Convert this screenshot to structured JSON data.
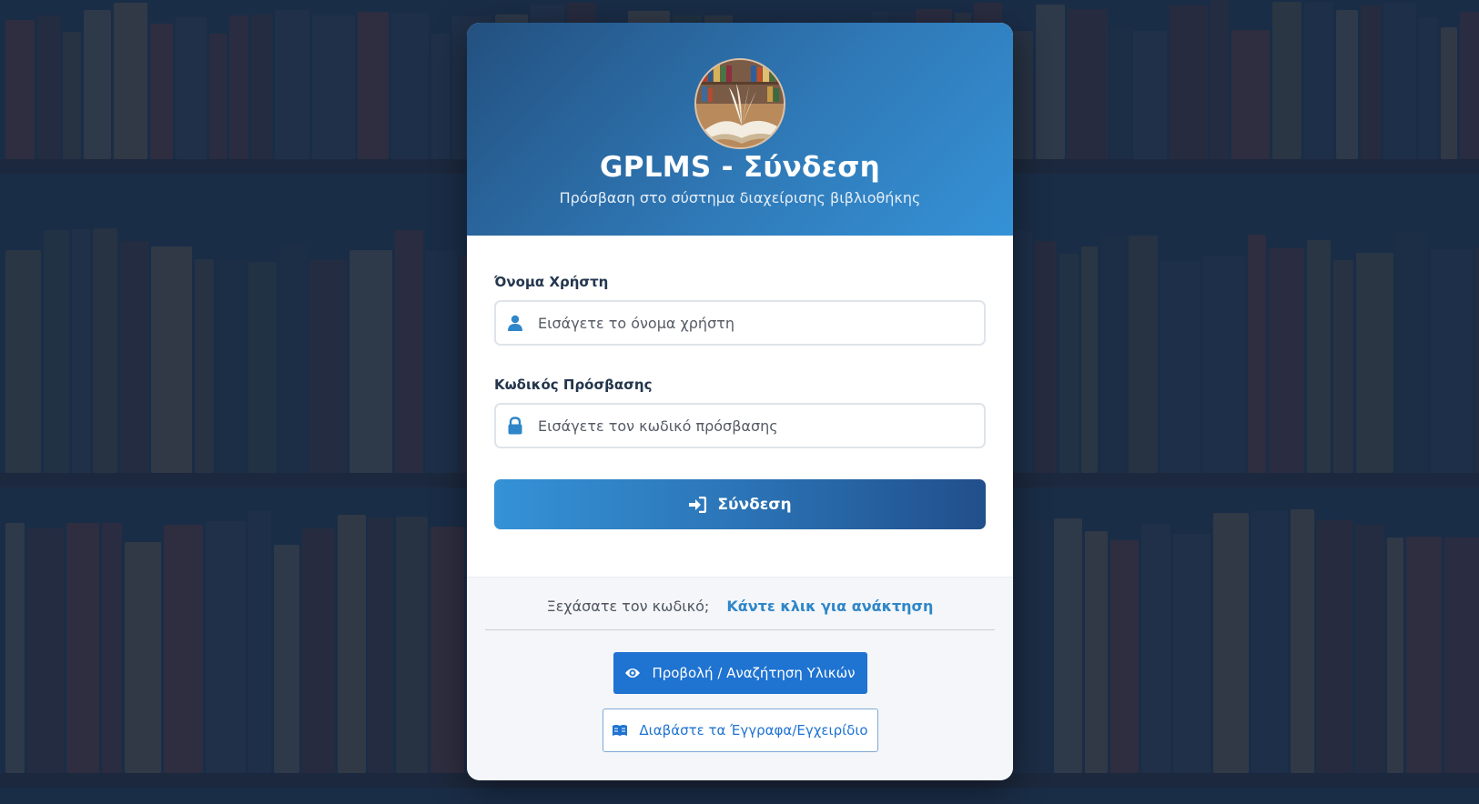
{
  "login": {
    "title": "GPLMS - Σύνδεση",
    "subtitle": "Πρόσβαση στο σύστημα διαχείρισης βιβλιοθήκης",
    "username_label": "Όνομα Χρήστη",
    "username_placeholder": "Εισάγετε το όνομα χρήστη",
    "username_icon": "user-icon",
    "password_label": "Κωδικός Πρόσβασης",
    "password_placeholder": "Εισάγετε τον κωδικό πρόσβασης",
    "password_icon": "lock-icon",
    "submit_label": "Σύνδεση",
    "submit_icon": "sign-in-icon"
  },
  "footer": {
    "forgot_text": "Ξεχάσατε τον κωδικό;",
    "recover_link": "Κάντε κλικ για ανάκτηση",
    "view_materials_label": "Προβολή / Αναζήτηση Υλικών",
    "view_materials_icon": "eye-icon",
    "docs_label": "Διαβάστε τα Έγγραφα/Εγχειρίδιο",
    "docs_icon": "book-open-icon"
  },
  "colors": {
    "header_gradient_start": "#23507f",
    "header_gradient_end": "#3592d6",
    "primary_button": "#1f73d1",
    "link": "#2f86c8",
    "background_overlay": "#182c46"
  }
}
